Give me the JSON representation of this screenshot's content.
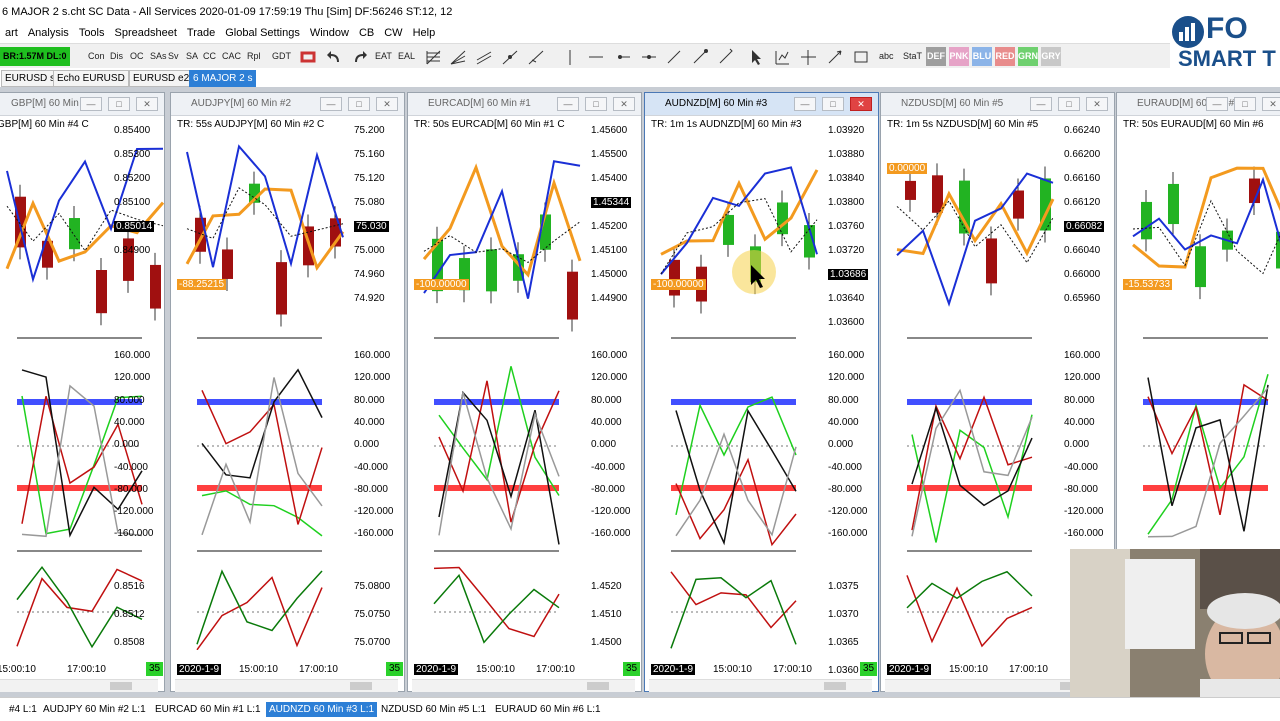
{
  "window": {
    "title": "6 MAJOR 2 s.cht  SC Data - All Services 2020-01-09  17:59:19 Thu [Sim]  DF:56246  ST:12, 12"
  },
  "menu": [
    "art",
    "Analysis",
    "Tools",
    "Spreadsheet",
    "Trade",
    "Global Settings",
    "Window",
    "CB",
    "CW",
    "Help"
  ],
  "toolbar": {
    "account": "BR:1.57M DL:0",
    "buttons": [
      "Con",
      "Dis",
      "OC",
      "SAs",
      "Sv",
      "SA",
      "CC",
      "CAC",
      "Rpl",
      "GDT",
      "EAT",
      "EAL",
      "abc",
      "StaT"
    ],
    "color_buttons": [
      {
        "label": "DEF",
        "bg": "#9e9e9e"
      },
      {
        "label": "PNK",
        "bg": "#e6a3c7"
      },
      {
        "label": "BLU",
        "bg": "#8cb4e8"
      },
      {
        "label": "RED",
        "bg": "#e88c8c"
      },
      {
        "label": "GRN",
        "bg": "#6fd06f"
      },
      {
        "label": "GRY",
        "bg": "#c8c8c8"
      }
    ]
  },
  "chartbook_tabs": [
    "EURUSD s",
    "Echo EURUSD",
    "EURUSD e2",
    "6 MAJOR 2 s"
  ],
  "logo": {
    "line1": "FO",
    "line2": "SMART T"
  },
  "panes": [
    {
      "id": "gbp",
      "title": "GBP[M]  60 Min  #4",
      "label": "GBP[M]  60 Min  #4 C",
      "active": false,
      "y1": [
        "0.85400",
        "0.85300",
        "0.85200",
        "0.85100",
        "0.85014",
        "0.84900"
      ],
      "flag1": "",
      "current": "0.85014",
      "y2": [
        "160.000",
        "120.000",
        "80.000",
        "40.000",
        "0.000",
        "-40.000",
        "-80.000",
        "-120.000",
        "-160.000"
      ],
      "y3": [
        "0.8516",
        "0.8512",
        "0.8508"
      ],
      "dates": [
        "",
        "15:00:10",
        "17:00:10"
      ],
      "badge": "35"
    },
    {
      "id": "audjpy",
      "title": "AUDJPY[M]  60 Min  #2",
      "label": "TR: 55s AUDJPY[M]  60 Min  #2 C",
      "active": false,
      "y1": [
        "75.200",
        "75.160",
        "75.120",
        "75.080",
        "75.030",
        "75.000",
        "74.960",
        "74.920"
      ],
      "flag1": "-88.25215",
      "current": "75.030",
      "y2": [
        "160.000",
        "120.000",
        "80.000",
        "40.000",
        "0.000",
        "-40.000",
        "-80.000",
        "-120.000",
        "-160.000"
      ],
      "y3": [
        "75.0800",
        "75.0750",
        "75.0700"
      ],
      "dates": [
        "2020-1-9",
        "15:00:10",
        "17:00:10"
      ],
      "badge": "35"
    },
    {
      "id": "eurcad",
      "title": "EURCAD[M]  60 Min  #1",
      "label": "TR: 50s EURCAD[M]  60 Min  #1 C",
      "active": false,
      "y1": [
        "1.45600",
        "1.45500",
        "1.45400",
        "1.45344",
        "1.45200",
        "1.45100",
        "1.45000",
        "1.44900"
      ],
      "flag1": "-100.00000",
      "current": "1.45344",
      "y2": [
        "160.000",
        "120.000",
        "80.000",
        "40.000",
        "0.000",
        "-40.000",
        "-80.000",
        "-120.000",
        "-160.000"
      ],
      "y3": [
        "1.4520",
        "1.4510",
        "1.4500"
      ],
      "dates": [
        "2020-1-9",
        "15:00:10",
        "17:00:10"
      ],
      "badge": "35"
    },
    {
      "id": "audnzd",
      "title": "AUDNZD[M]  60 Min  #3",
      "label": "TR: 1m 1s AUDNZD[M]  60 Min  #3",
      "active": true,
      "y1": [
        "1.03920",
        "1.03880",
        "1.03840",
        "1.03800",
        "1.03760",
        "1.03720",
        "1.03686",
        "1.03640",
        "1.03600"
      ],
      "flag1": "-100.00000",
      "current": "1.03686",
      "y2": [
        "160.000",
        "120.000",
        "80.000",
        "40.000",
        "0.000",
        "-40.000",
        "-80.000",
        "-120.000",
        "-160.000"
      ],
      "y3": [
        "1.0375",
        "1.0370",
        "1.0365",
        "1.0360"
      ],
      "dates": [
        "2020-1-9",
        "15:00:10",
        "17:00:10"
      ],
      "badge": "35"
    },
    {
      "id": "nzdusd",
      "title": "NZDUSD[M]  60 Min  #5",
      "label": "TR: 1m 5s NZDUSD[M]  60 Min  #5",
      "active": false,
      "y1": [
        "0.66240",
        "0.66200",
        "0.66160",
        "0.66120",
        "0.66082",
        "0.66040",
        "0.66000",
        "0.65960"
      ],
      "flag1": "0.00000",
      "current": "0.66082",
      "y2": [
        "160.000",
        "120.000",
        "80.000",
        "40.000",
        "0.000",
        "-40.000",
        "-80.000",
        "-120.000",
        "-160.000"
      ],
      "y3": [],
      "dates": [
        "2020-1-9",
        "15:00:10",
        "17:00:10"
      ],
      "badge": ""
    },
    {
      "id": "euraud",
      "title": "EURAUD[M]  60 Min  #6",
      "label": "TR: 50s EURAUD[M]  60 Min  #6",
      "active": false,
      "y1": [],
      "flag1": "-15.53733",
      "current": "",
      "y2": [],
      "y3": [],
      "dates": [],
      "badge": ""
    }
  ],
  "bottom_tabs": [
    "#4  L:1",
    "AUDJPY  60 Min  #2  L:1",
    "EURCAD  60 Min  #1  L:1",
    "AUDNZD  60 Min  #3  L:1",
    "NZDUSD  60 Min  #5  L:1",
    "EURAUD  60 Min  #6  L:1"
  ],
  "colors": {
    "accent": "#2d7fd6",
    "up": "#22b322",
    "down": "#a01010",
    "orange": "#f39a1f",
    "blue": "#1a2fd6",
    "band_blue": "#2c3cff",
    "band_red": "#ff2a2a"
  }
}
